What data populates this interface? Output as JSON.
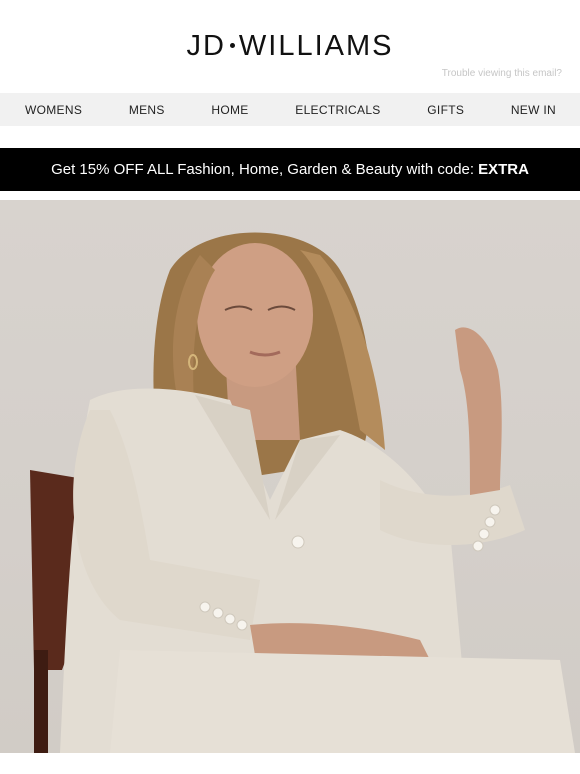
{
  "brand": {
    "name_left": "JD",
    "name_right": "WILLIAMS"
  },
  "header": {
    "trouble_link": "Trouble viewing this email?"
  },
  "nav": [
    "WOMENS",
    "MENS",
    "HOME",
    "ELECTRICALS",
    "GIFTS",
    "NEW IN"
  ],
  "promo": {
    "text": "Get 15% OFF ALL Fashion, Home, Garden & Beauty with code:",
    "code": "EXTRA"
  },
  "colors": {
    "promo_bg": "#000000",
    "nav_bg": "#f1f1f1",
    "hero_bg": "#d6d1cc"
  }
}
